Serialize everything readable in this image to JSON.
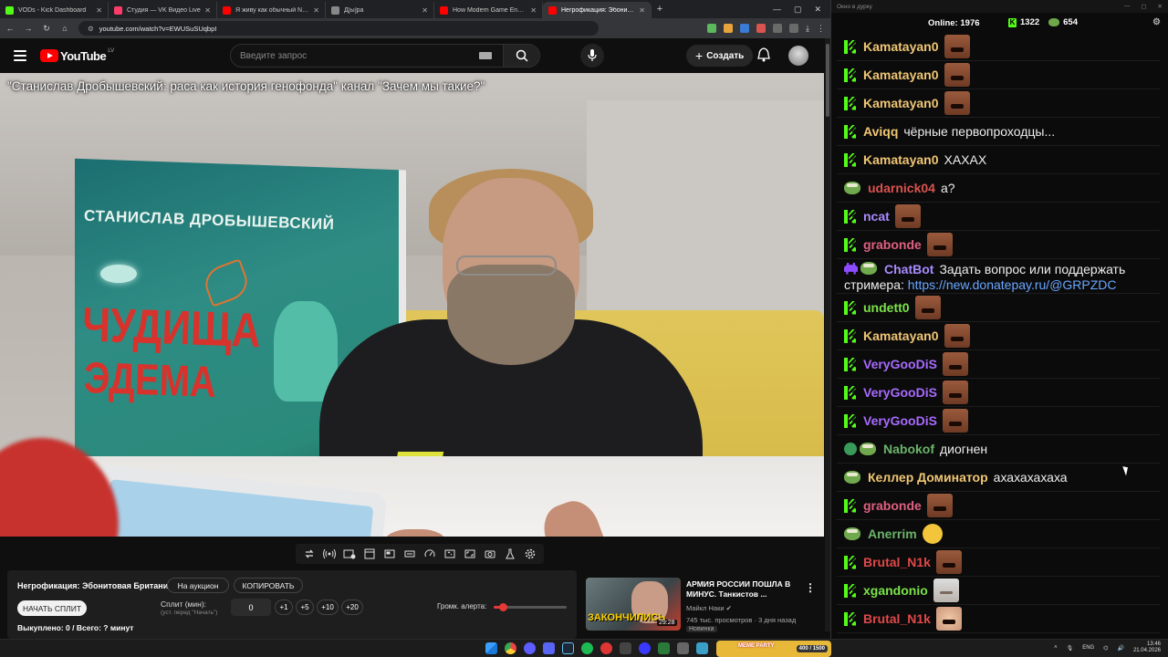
{
  "browser": {
    "tabs": [
      {
        "label": "VODs - Kick Dashboard",
        "color": "#53fc18",
        "active": false
      },
      {
        "label": "Студия — VK Видео Live",
        "color": "#ff3b6b",
        "active": false
      },
      {
        "label": "Я живу как обычный NPC в К...",
        "color": "#ff0000",
        "active": false
      },
      {
        "label": "Д[ы]ра",
        "color": "#888888",
        "active": false
      },
      {
        "label": "How Modern Game Engines D...",
        "color": "#ff0000",
        "active": false
      },
      {
        "label": "Негрофикация: Эбонитова...",
        "color": "#ff0000",
        "active": true
      }
    ],
    "url": "youtube.com/watch?v=EWUSuSUqbpI"
  },
  "youtube": {
    "logo_text": "YouTube",
    "country": "LV",
    "search_placeholder": "Введите запрос",
    "create_label": "Создать",
    "video_overlay_title": "\"Станислав Дробышевский: раса как история генофонда\" канал \"Зачем мы такие?\"",
    "poster_author": "СТАНИСЛАВ ДРОБЫШЕВСКИЙ",
    "poster_title_1": "ЧУДИЩА",
    "poster_title_2": "ЭДЕМА"
  },
  "panel": {
    "title": "Негрофикация: Эбонитовая Британия.",
    "auction_button": "На аукцион",
    "copy_button": "КОПИРОВАТЬ",
    "split_button": "НАЧАТЬ СПЛИТ",
    "split_label": "Сплит (мин):",
    "split_sub": "(уст. перед \"Начать\")",
    "split_value": "0",
    "increments": [
      "+1",
      "+5",
      "+10",
      "+20"
    ],
    "alert_label": "Громк. алерта:",
    "alert_volume": 0.12,
    "bought": "Выкуплено: 0 / Всего: ? минут"
  },
  "recommended": {
    "title": "АРМИЯ РОССИИ ПОШЛА В МИНУС. Танкистов ...",
    "channel": "Майкл Наки",
    "meta": "745 тыс. просмотров · 3 дня назад",
    "badge": "Новинка",
    "duration": "29:28",
    "thumb_text": "ЗАКОНЧИЛИСЬ"
  },
  "chat": {
    "window_title": "Окно в дурку",
    "online_label": "Online:",
    "online_count": "1976",
    "kick_viewers": "1322",
    "vk_viewers": "654",
    "messages": [
      {
        "badge": "kick",
        "user": "Kamatayan0",
        "color": "#f0c674",
        "text": "",
        "emote": "face"
      },
      {
        "badge": "kick",
        "user": "Kamatayan0",
        "color": "#f0c674",
        "text": "",
        "emote": "face"
      },
      {
        "badge": "kick",
        "user": "Kamatayan0",
        "color": "#f0c674",
        "text": "",
        "emote": "face"
      },
      {
        "badge": "kick",
        "user": "Aviqq",
        "color": "#f0c674",
        "text": "чёрные первопроходцы...",
        "emote": ""
      },
      {
        "badge": "kick",
        "user": "Kamatayan0",
        "color": "#f0c674",
        "text": "ХАХАХ",
        "emote": ""
      },
      {
        "badge": "pepe",
        "user": "udarnick04",
        "color": "#d9534f",
        "text": "а?",
        "emote": ""
      },
      {
        "badge": "kick",
        "user": "ncat",
        "color": "#a88bff",
        "text": "",
        "emote": "face"
      },
      {
        "badge": "kick",
        "user": "grabonde",
        "color": "#e06080",
        "text": "",
        "emote": "face"
      },
      {
        "badge": "chatbot",
        "user": "ChatBot",
        "color": "#a88bff",
        "text": "Задать вопрос или поддержать",
        "line2": "стримера:",
        "link": "https://new.donatepay.ru/@GRPZDC"
      },
      {
        "badge": "kick",
        "user": "undett0",
        "color": "#7be34a",
        "text": "",
        "emote": "face"
      },
      {
        "badge": "kick",
        "user": "Kamatayan0",
        "color": "#f0c674",
        "text": "",
        "emote": "face"
      },
      {
        "badge": "kick",
        "user": "VeryGooDiS",
        "color": "#a86bff",
        "text": "",
        "emote": "face"
      },
      {
        "badge": "kick",
        "user": "VeryGooDiS",
        "color": "#a86bff",
        "text": "",
        "emote": "face"
      },
      {
        "badge": "kick",
        "user": "VeryGooDiS",
        "color": "#a86bff",
        "text": "",
        "emote": "face"
      },
      {
        "badge": "verified-pepe",
        "user": "Nabokof",
        "color": "#6bb36b",
        "text": "диогнен",
        "emote": ""
      },
      {
        "badge": "pepe",
        "user": "Келлер Доминатор",
        "color": "#f0c674",
        "text": "ахахахахаха",
        "emote": ""
      },
      {
        "badge": "kick",
        "user": "grabonde",
        "color": "#e06080",
        "text": "",
        "emote": "face"
      },
      {
        "badge": "pepe",
        "user": "Anerrim",
        "color": "#6bb36b",
        "text": "",
        "emote": "shrug"
      },
      {
        "badge": "kick",
        "user": "Brutal_N1k",
        "color": "#e04848",
        "text": "",
        "emote": "face"
      },
      {
        "badge": "kick",
        "user": "xgandonio",
        "color": "#7be34a",
        "text": "",
        "emote": "cat"
      },
      {
        "badge": "kick",
        "user": "Brutal_N1k",
        "color": "#e04848",
        "text": "",
        "emote": "face2"
      }
    ]
  },
  "taskbar": {
    "widget_label": "MEME PARTY",
    "widget_count": "400 / 1500",
    "lang": "ENG",
    "time": "13:46",
    "date": "21.04.2026"
  }
}
